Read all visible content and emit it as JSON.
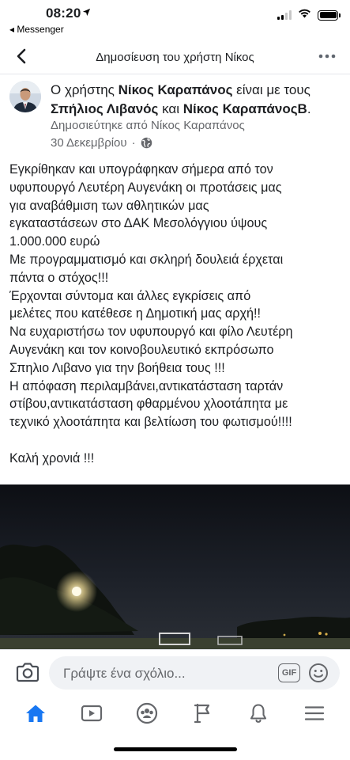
{
  "status_bar": {
    "time": "08:20",
    "back_app": "◂ Messenger"
  },
  "header": {
    "title": "Δημοσίευση του χρήστη Νίκος",
    "back_icon": "chevron-left-icon",
    "more_icon": "more-horizontal-icon"
  },
  "post": {
    "meta": {
      "prefix": "Ο χρήστης ",
      "author": "Νίκος Καραπάνος",
      "middle": " είναι με τους ",
      "tag1": "Σπήλιος Λιβανός",
      "and": " και ",
      "tag2": "Νίκος ΚαραπάνοςΒ",
      "suffix": "."
    },
    "published_by": "Δημοσιεύτηκε από Νίκος Καραπάνος",
    "date": "30 Δεκεμβρίου",
    "date_separator": "·",
    "privacy_icon": "globe-icon",
    "body_lines": [
      "Εγκρίθηκαν και υπογράφηκαν σήμερα από τον",
      "υφυπουργό Λευτέρη Αυγενάκη οι προτάσεις μας",
      "για αναβάθμιση των αθλητικών μας",
      "εγκαταστάσεων στο ΔΑΚ Μεσολόγγιου ύψους",
      "1.000.000 ευρώ",
      "Με προγραμματισμό και σκληρή δουλειά έρχεται",
      "πάντα ο στόχος!!!",
      "Έρχονται σύντομα και άλλες εγκρίσεις από",
      "μελέτες που κατέθεσε η Δημοτική μας αρχή!!",
      "Να ευχαριστήσω τον υφυπουργό και φίλο Λευτέρη",
      "Αυγενάκη και τον κοινοβουλευτικό εκπρόσωπο",
      "Σπηλιο Λιβανο για την βοήθεια τους !!!",
      "Η απόφαση περιλαμβάνει,αντικατάσταση ταρτάν",
      "στίβου,αντικατάσταση φθαρμένου χλοοτάπητα με",
      "τεχνικό χλοοτάπητα και βελτίωση του φωτισμού!!!!",
      "",
      "Καλή χρονιά !!!"
    ]
  },
  "comment_bar": {
    "camera_icon": "camera-icon",
    "placeholder": "Γράψτε ένα σχόλιο...",
    "gif_label": "GIF",
    "emoji_icon": "emoji-icon"
  },
  "tabs": [
    {
      "icon": "home-icon",
      "active": true
    },
    {
      "icon": "watch-video-icon",
      "active": false
    },
    {
      "icon": "groups-icon",
      "active": false
    },
    {
      "icon": "pages-flag-icon",
      "active": false
    },
    {
      "icon": "notifications-bell-icon",
      "active": false
    },
    {
      "icon": "menu-icon",
      "active": false
    }
  ],
  "colors": {
    "accent": "#1877f2",
    "secondary_text": "#65676b",
    "primary_text": "#1c1e21"
  }
}
